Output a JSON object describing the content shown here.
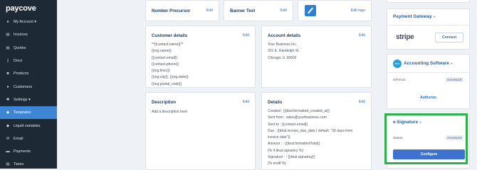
{
  "brand": {
    "logo": "paycove"
  },
  "sidebar": {
    "items": [
      {
        "label": "My Account ▾",
        "icon": "user-icon",
        "active": false
      },
      {
        "label": "Invoices",
        "icon": "invoice-icon",
        "active": false
      },
      {
        "label": "Quotes",
        "icon": "quote-icon",
        "active": false
      },
      {
        "label": "Docs",
        "icon": "doc-icon",
        "active": false
      },
      {
        "label": "Products",
        "icon": "box-icon",
        "active": false
      },
      {
        "label": "Customers",
        "icon": "people-icon",
        "active": false
      },
      {
        "label": "Settings ▾",
        "icon": "gear-icon",
        "active": false
      },
      {
        "label": "Templates",
        "icon": "template-icon",
        "active": true
      },
      {
        "label": "Liquid variables",
        "icon": "variables-icon",
        "active": false
      },
      {
        "label": "Email",
        "icon": "mail-icon",
        "active": false
      },
      {
        "label": "Payments",
        "icon": "card-icon",
        "active": false
      },
      {
        "label": "Taxes",
        "icon": "tax-icon",
        "active": false
      }
    ]
  },
  "top_row": {
    "number_precursor": {
      "title": "Number Precursor",
      "edit": "Edit"
    },
    "banner_text": {
      "title": "Banner Text",
      "edit": "Edit"
    },
    "logo": {
      "edit": "Edit logo"
    }
  },
  "customer_details": {
    "title": "Customer details",
    "edit": "Edit",
    "lines": [
      "**{{contact.name}}**",
      "{{org.name}}",
      "{{contact.email}}",
      "{{contact.phone}}",
      "{{org.line1}}",
      "{{org.city}}, {{org.state}}",
      "{{org.postal_code}}"
    ]
  },
  "account_details": {
    "title": "Account details",
    "edit": "Edit",
    "lines": [
      "Your Business Inc.",
      "201 E. Randolph St.",
      "Chicago, IL 60602"
    ]
  },
  "description": {
    "title": "Description",
    "edit": "Edit",
    "placeholder": "Add a description here"
  },
  "details": {
    "title": "Details",
    "edit": "Edit",
    "lines": [
      "Created : {{deal.formatted_created_at}}",
      "Sent from : sales@yourbusiness.com",
      "Sent to : {{contact.email}}",
      "Due : {{deal.invoice_due_date | default: \"30 days from",
      "invoice date\"}}",
      "Amount : : {{deal.formattedTotal}}",
      "{% if deal.signatory %}",
      "Signature : : {{deal.signatory}}",
      "{% endif %}"
    ]
  },
  "right_panel": {
    "payment_gateway": {
      "title": "Payment Gateway",
      "provider": "stripe",
      "button": "Connect"
    },
    "accounting": {
      "title": "Accounting Software",
      "logo_text": "xero",
      "status_label": "STATUS",
      "status": "DISABLED",
      "button": "Authorize"
    },
    "esignature": {
      "title": "e-Signature",
      "status_label": "Status",
      "status": "DISABLED",
      "button": "Configure"
    }
  },
  "colors": {
    "sidebar_bg": "#1d2935",
    "active": "#3d86d6",
    "accent": "#2f6bb2",
    "highlight": "#2fb04a"
  }
}
